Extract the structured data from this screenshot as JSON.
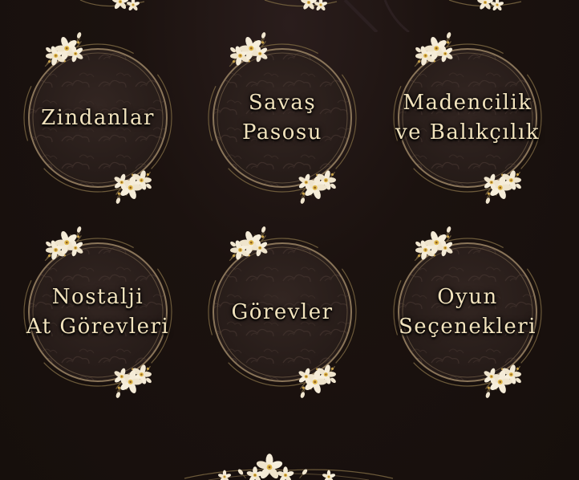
{
  "menu": {
    "items": [
      {
        "id": "dungeons",
        "label": "Zindanlar"
      },
      {
        "id": "battle-pass",
        "label": "Savaş\nPasosu"
      },
      {
        "id": "mining-fishing",
        "label": "Madencilik\nve Balıkçılık"
      },
      {
        "id": "nostalgia-horse-quests",
        "label": "Nostalji\nAt Görevleri"
      },
      {
        "id": "quests",
        "label": "Görevler"
      },
      {
        "id": "game-options",
        "label": "Oyun\nSeçenekleri"
      }
    ]
  },
  "colors": {
    "background": "#1c1310",
    "disc": "#2b201d",
    "ring": "#8a7559",
    "text": "#f2e3bd",
    "flower": "#f5ecd8",
    "flower_center": "#e0b84a"
  },
  "icons": {
    "frame_ornament": "flower-cluster-icon",
    "disc_pattern": "cloud-pattern"
  }
}
